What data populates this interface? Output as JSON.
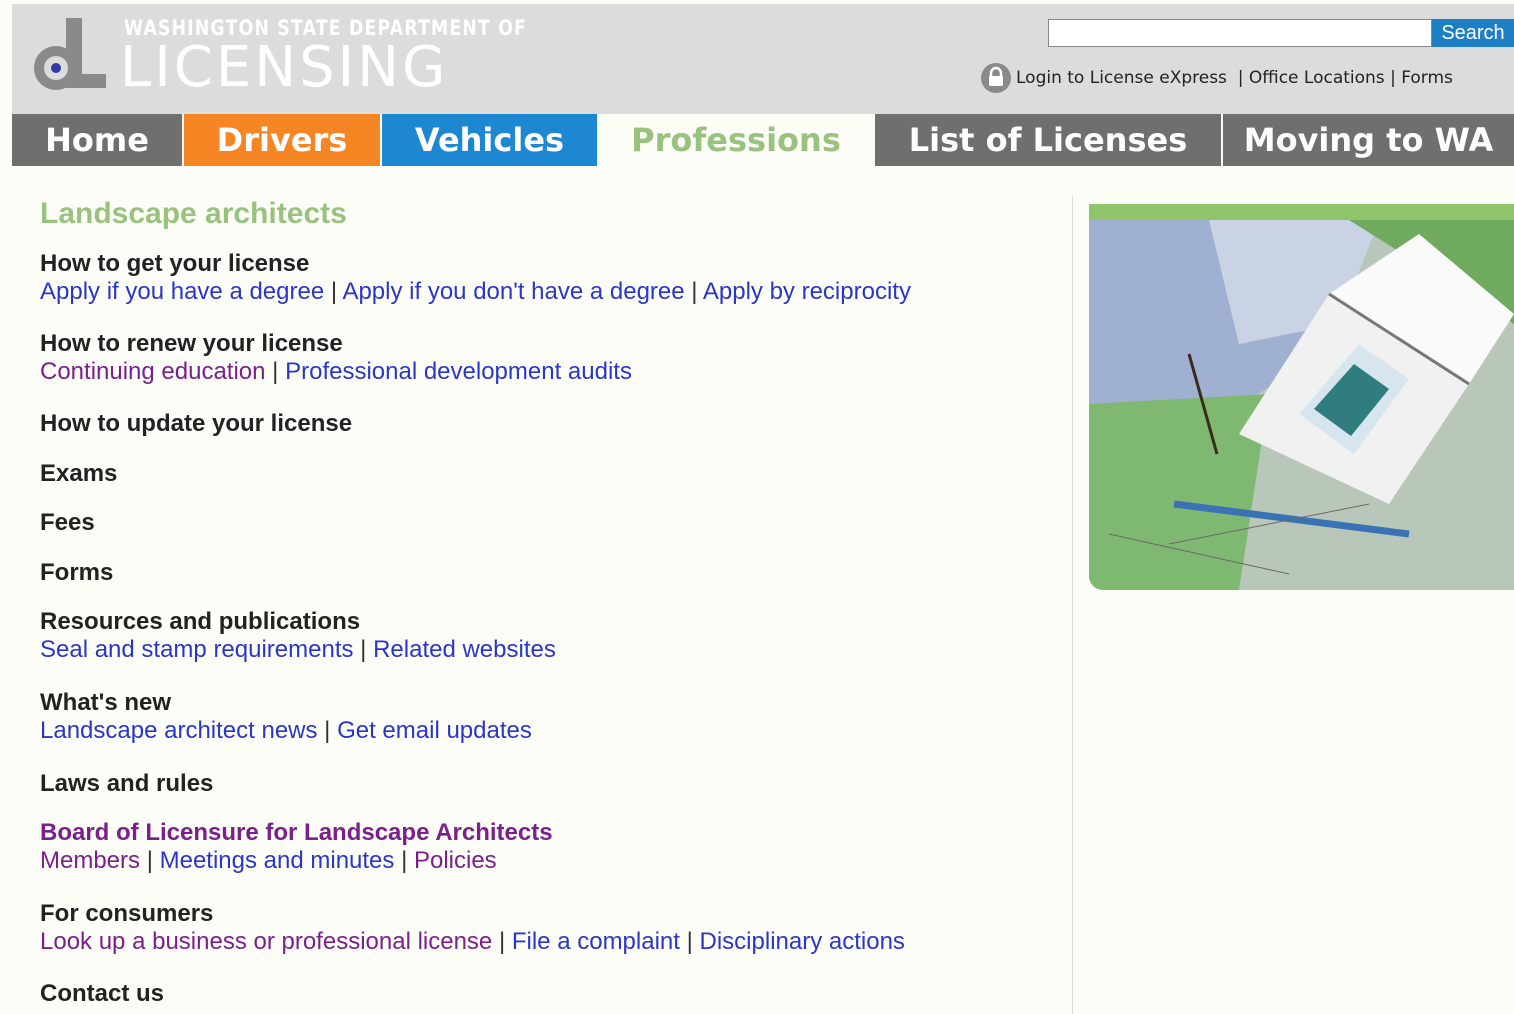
{
  "header": {
    "agency_line": "WASHINGTON STATE DEPARTMENT OF",
    "agency_name": "LICENSING",
    "search": {
      "button_label": "Search",
      "value": ""
    },
    "util_links": [
      {
        "label": "Login to License eXpress"
      },
      {
        "label": "Office Locations"
      },
      {
        "label": "Forms"
      }
    ]
  },
  "nav": {
    "tabs": [
      {
        "label": "Home",
        "color": "#6f6f6f"
      },
      {
        "label": "Drivers",
        "color": "#f68524"
      },
      {
        "label": "Vehicles",
        "color": "#1e87d2"
      },
      {
        "label": "Professions",
        "color": "#99c27f",
        "active": true
      },
      {
        "label": "List of Licenses",
        "color": "#6f6f6f"
      },
      {
        "label": "Moving to WA",
        "color": "#6f6f6f"
      }
    ]
  },
  "main": {
    "title": "Landscape architects",
    "sections": {
      "get": {
        "heading": "How to get your license",
        "links": [
          "Apply if you have a degree",
          "Apply if you don't have a degree",
          "Apply by reciprocity"
        ]
      },
      "renew": {
        "heading": "How to renew your license",
        "links": [
          "Continuing education",
          "Professional development audits"
        ]
      },
      "update": {
        "heading": "How to update your license"
      },
      "exams": {
        "heading": "Exams"
      },
      "fees": {
        "heading": "Fees"
      },
      "forms": {
        "heading": "Forms"
      },
      "resources": {
        "heading": "Resources and publications",
        "links": [
          "Seal and stamp requirements",
          "Related websites"
        ]
      },
      "news": {
        "heading": "What's new",
        "links": [
          "Landscape architect news",
          "Get email updates"
        ]
      },
      "laws": {
        "heading": "Laws and rules"
      },
      "board": {
        "heading": "Board of Licensure for Landscape Architects",
        "links": [
          "Members",
          "Meetings and minutes",
          "Policies"
        ]
      },
      "consumers": {
        "heading": "For consumers",
        "links": [
          "Look up a business or professional license",
          "File a complaint",
          "Disciplinary actions"
        ]
      },
      "contact": {
        "heading": "Contact us"
      }
    }
  },
  "colors": {
    "accent_green": "#99c27f",
    "link_blue": "#2a36c8",
    "link_visited": "#7b1f8d",
    "header_bg": "#dcdcdc"
  }
}
